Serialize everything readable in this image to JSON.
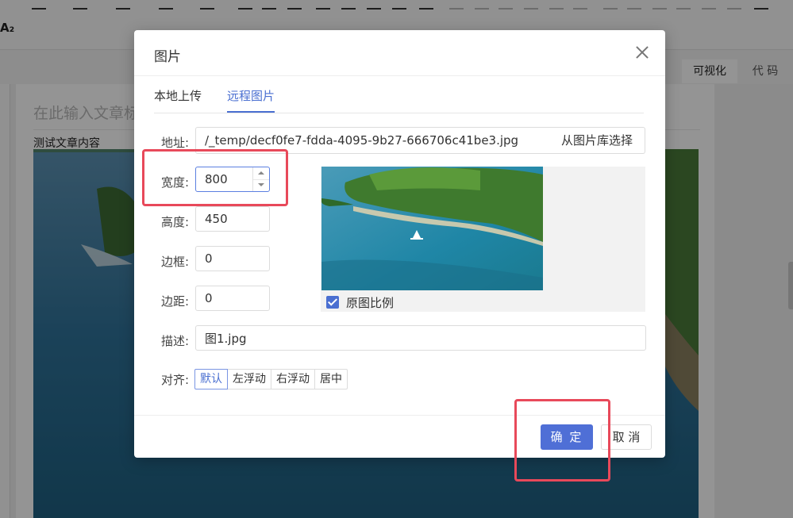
{
  "editor": {
    "az_label": "A₂",
    "mode_tabs": [
      "可视化",
      "代 码"
    ],
    "doc_title_placeholder": "在此输入文章标",
    "doc_text": "测试文章内容"
  },
  "dialog": {
    "title": "图片",
    "tabs": [
      "本地上传",
      "远程图片"
    ],
    "active_tab": "远程图片",
    "address_label": "地址:",
    "address_value": "/_temp/decf0fe7-fdda-4095-9b27-666706c41be3.jpg",
    "gallery_button": "从图片库选择",
    "width_label": "宽度:",
    "width_value": "800",
    "height_label": "高度:",
    "height_value": "450",
    "border_label": "边框:",
    "border_value": "0",
    "margin_label": "边距:",
    "margin_value": "0",
    "ratio_checkbox_label": "原图比例",
    "ratio_checked": true,
    "description_label": "描述:",
    "description_value": "图1.jpg",
    "align_label": "对齐:",
    "align_options": [
      "默认",
      "左浮动",
      "右浮动",
      "居中"
    ],
    "align_selected": "默认",
    "ok_button": "确 定",
    "cancel_button": "取 消"
  },
  "colors": {
    "accent": "#4a6fd1",
    "highlight_box": "#e8495a",
    "primary_button": "#4f6fd6"
  }
}
